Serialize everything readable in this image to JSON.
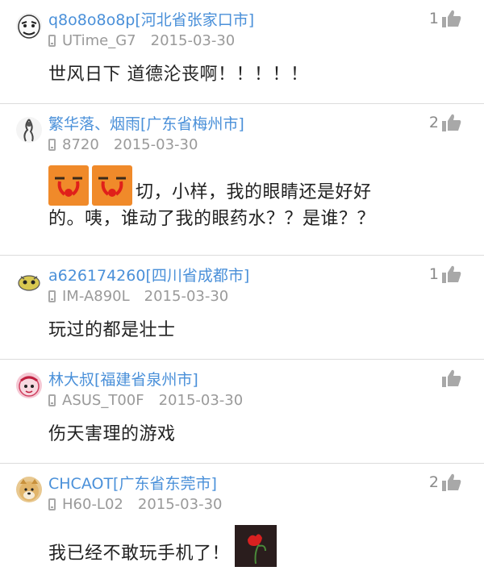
{
  "comments": [
    {
      "username": "q8o8o8o8p[河北省张家口市]",
      "device": "UTime_G7",
      "date": "2015-03-30",
      "likes": "1",
      "text": "世风日下 道德沦丧啊！！！！！",
      "avatar": "meme-face-avatar"
    },
    {
      "username": "繁华落、烟雨[广东省梅州市]",
      "device": "8720",
      "date": "2015-03-30",
      "likes": "2",
      "text_line1": "切，小样，我的眼睛还是好好",
      "text_line2": "的。咦，谁动了我的眼药水？？是谁？？",
      "avatar": "ink-figure-avatar"
    },
    {
      "username": "a626174260[四川省成都市]",
      "device": "IM-A890L",
      "date": "2015-03-30",
      "likes": "1",
      "text": "玩过的都是壮士",
      "avatar": "cartoon-avatar"
    },
    {
      "username": "林大叔[福建省泉州市]",
      "device": "ASUS_T00F",
      "date": "2015-03-30",
      "likes": "",
      "text": "伤天害理的游戏",
      "avatar": "pink-cartoon-avatar"
    },
    {
      "username": "CHCAOT[广东省东莞市]",
      "device": "H60-L02",
      "date": "2015-03-30",
      "likes": "2",
      "text": "我已经不敢玩手机了！",
      "avatar": "doge-avatar"
    }
  ],
  "colors": {
    "username": "#4a90d9",
    "meta": "#9a9a9a",
    "text": "#222222",
    "divider": "#dcdcdc",
    "thumb": "#a8a8a8"
  }
}
